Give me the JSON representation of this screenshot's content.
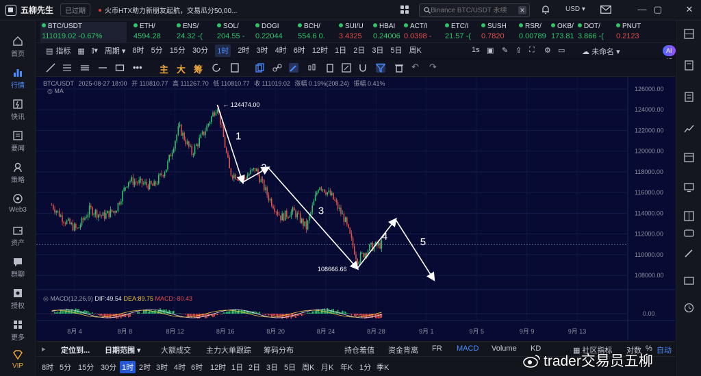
{
  "app": {
    "title": "五柳先生",
    "status": "已过期"
  },
  "news": "火币HTX助力新朋友起航，交易瓜分50,00...",
  "search": {
    "placeholder": "Binance BTC/USDT 永续"
  },
  "currency": "USD",
  "sidebar": {
    "items": [
      {
        "label": "首页",
        "icon": "home-icon"
      },
      {
        "label": "行情",
        "icon": "chart-bars-icon",
        "active": true
      },
      {
        "label": "快讯",
        "icon": "flash-icon"
      },
      {
        "label": "要闻",
        "icon": "news-icon"
      },
      {
        "label": "策略",
        "icon": "strategy-icon"
      },
      {
        "label": "Web3",
        "icon": "web3-icon"
      },
      {
        "label": "资产",
        "icon": "wallet-icon"
      },
      {
        "label": "群聊",
        "icon": "chat-icon"
      },
      {
        "label": "授权",
        "icon": "authorize-icon"
      },
      {
        "label": "更多",
        "icon": "more-icon"
      },
      {
        "label": "VIP",
        "icon": "vip-icon"
      }
    ]
  },
  "tickers": [
    {
      "name": "BTC/USDT",
      "price": "111019.02 -0.67%",
      "dir": "up",
      "active": true
    },
    {
      "name": "ETH/",
      "price": "4594.28",
      "dir": "up"
    },
    {
      "name": "ENS/",
      "price": "24.32 -(",
      "dir": "up"
    },
    {
      "name": "SOL/",
      "price": "204.55 -",
      "dir": "up"
    },
    {
      "name": "DOGI",
      "price": "0.22044",
      "dir": "up"
    },
    {
      "name": "BCH/",
      "price": "554.6 0.",
      "dir": "up"
    },
    {
      "name": "SUI/U",
      "price": "3.4325",
      "dir": "down"
    },
    {
      "name": "HBAI",
      "price": "0.24006",
      "dir": "up"
    },
    {
      "name": "ACT/I",
      "price": "0.0398 -",
      "dir": "down"
    },
    {
      "name": "ETC/I",
      "price": "21.57 -(",
      "dir": "up"
    },
    {
      "name": "SUSH",
      "price": "0.7820",
      "dir": "down"
    },
    {
      "name": "RSR/",
      "price": "0.00789",
      "dir": "up"
    },
    {
      "name": "OKB/",
      "price": "173.81",
      "dir": "up"
    },
    {
      "name": "DOT/",
      "price": "3.866 -(",
      "dir": "up"
    },
    {
      "name": "PNUT",
      "price": "0.2123",
      "dir": "down"
    }
  ],
  "period_bar": {
    "indicator_label": "指标",
    "period_label": "周期",
    "periods": [
      "8时",
      "5分",
      "15分",
      "30分",
      "1时",
      "2时",
      "3时",
      "4时",
      "6时",
      "12时",
      "1日",
      "2日",
      "3日",
      "5日",
      "周K"
    ],
    "active_period": "1时",
    "right_period": "1s",
    "unnamed": "未命名",
    "ai_label": "AI解读"
  },
  "draw_bar": {
    "main": "主",
    "big": "大",
    "fund": "筹"
  },
  "ohlc": {
    "symbol": "BTC/USDT",
    "datetime": "2025-08-27 18:00",
    "open": "开 110810.77",
    "high": "高 111267.70",
    "low": "低 110810.77",
    "close": "收 111019.02",
    "change": "涨幅 0.19%(208.24)",
    "amplitude": "振幅 0.41%",
    "ma_label": "MA"
  },
  "macd": {
    "label": "MACD(12,26,9)",
    "dif": "DIF:49.54",
    "dea": "DEA:89.75",
    "macd": "MACD:-80.43"
  },
  "chart_data": {
    "type": "candlestick",
    "symbol": "BTC/USDT",
    "interval": "1时",
    "y_ticks": [
      108000,
      110000,
      112000,
      114000,
      116000,
      118000,
      120000,
      122000,
      124000,
      126000
    ],
    "macd_zero": "0.00",
    "x_ticks": [
      "8月 4",
      "8月 8",
      "8月 12",
      "8月 16",
      "8月 20",
      "8月 24",
      "8月 28",
      "9月 1",
      "9月 5",
      "9月 9",
      "9月 13"
    ],
    "price_path": [
      [
        "2025-08-01",
        114800
      ],
      [
        "2025-08-02",
        113300
      ],
      [
        "2025-08-03",
        112400
      ],
      [
        "2025-08-04",
        114400
      ],
      [
        "2025-08-05",
        113700
      ],
      [
        "2025-08-06",
        114300
      ],
      [
        "2025-08-07",
        117200
      ],
      [
        "2025-08-08",
        116900
      ],
      [
        "2025-08-09",
        116600
      ],
      [
        "2025-08-10",
        118400
      ],
      [
        "2025-08-11",
        122300
      ],
      [
        "2025-08-12",
        119800
      ],
      [
        "2025-08-13",
        121900
      ],
      [
        "2025-08-14",
        124474
      ],
      [
        "2025-08-15",
        117900
      ],
      [
        "2025-08-16",
        117300
      ],
      [
        "2025-08-17",
        118300
      ],
      [
        "2025-08-18",
        115600
      ],
      [
        "2025-08-19",
        113600
      ],
      [
        "2025-08-20",
        114200
      ],
      [
        "2025-08-21",
        112600
      ],
      [
        "2025-08-22",
        116800
      ],
      [
        "2025-08-23",
        115600
      ],
      [
        "2025-08-24",
        113400
      ],
      [
        "2025-08-25",
        109500
      ],
      [
        "2025-08-26",
        110700
      ],
      [
        "2025-08-27",
        111019
      ]
    ],
    "annotations": {
      "high_label": "124474.00",
      "low_label": "108666.66",
      "wave_labels": [
        "1",
        "2",
        "3",
        "4",
        "5"
      ],
      "wave_points": [
        [
          "2025-08-14",
          124474
        ],
        [
          "2025-08-16",
          117000
        ],
        [
          "2025-08-18",
          118400
        ],
        [
          "2025-08-25",
          108666.66
        ],
        [
          "2025-08-28",
          113400
        ],
        [
          "2025-08-31",
          107600
        ]
      ]
    },
    "current_price": 111019.02
  },
  "indicator_bar": {
    "locate": "定位到...",
    "date_range": "日期范围",
    "items": [
      "大额成交",
      "主力大单跟踪",
      "筹码分布",
      "持仓羞值",
      "资金背离",
      "FR",
      "MACD",
      "Volume",
      "KD"
    ],
    "active": "MACD",
    "community": "社区指标",
    "log": "对数",
    "pct": "%",
    "auto": "自动"
  },
  "bottom_periods": {
    "items": [
      "8时",
      "5分",
      "15分",
      "30分",
      "1时",
      "2时",
      "3时",
      "4时",
      "6时",
      "12时",
      "1日",
      "2日",
      "3日",
      "5日",
      "周K",
      "月K",
      "年K",
      "1分",
      "季K"
    ],
    "active": "1时"
  },
  "watermark": "trader交易员五柳"
}
